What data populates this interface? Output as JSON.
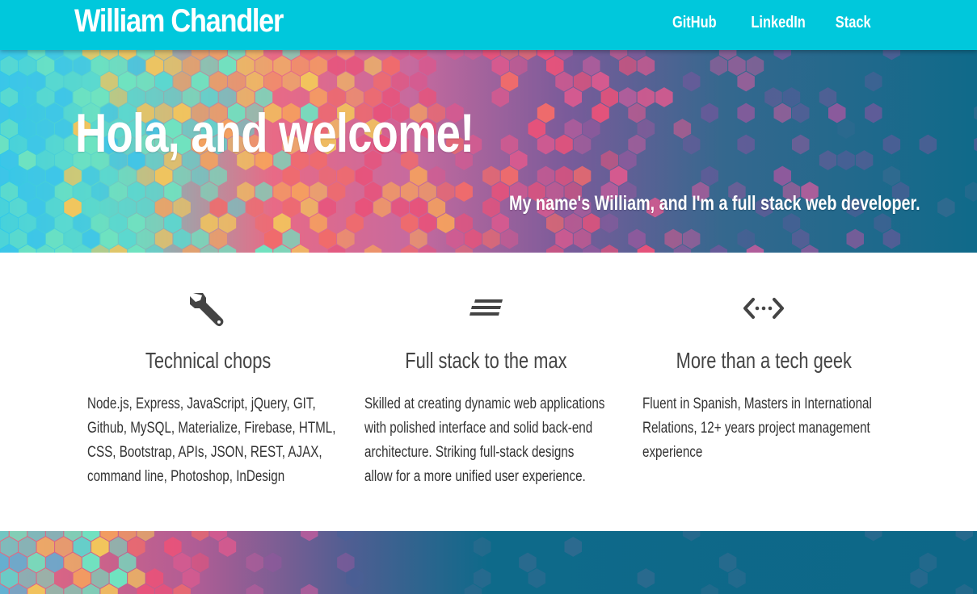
{
  "navbar": {
    "brand": "William Chandler",
    "links": [
      {
        "label": "GitHub"
      },
      {
        "label": "LinkedIn"
      },
      {
        "label": "Stack"
      }
    ],
    "background": "#00c8dc"
  },
  "hero": {
    "title": "Hola, and welcome!",
    "subtitle": "My name's William, and I'm a full stack web developer."
  },
  "features": [
    {
      "icon": "wrench-icon",
      "title": "Technical chops",
      "lines": [
        "Node.js, Express, JavaScript, jQuery, GIT,",
        "Github, MySQL, Materialize, Firebase, HTML,",
        "CSS, Bootstrap, APIs, JSON, REST, AJAX,",
        "command line, Photoshop, InDesign"
      ]
    },
    {
      "icon": "stacked-lines-icon",
      "title": "Full stack to the max",
      "lines": [
        "Skilled at creating dynamic web applications",
        "with polished interface and solid back-end",
        "architecture. Striking full-stack designs",
        "allow for a more unified user experience."
      ]
    },
    {
      "icon": "code-arrows-icon",
      "title": "More than a tech geek",
      "lines": [
        "Fluent in Spanish, Masters in International",
        "Relations, 12+ years project management",
        "experience"
      ]
    }
  ],
  "colors": {
    "accent": "#00c8dc",
    "text": "#333333",
    "heading": "#444444",
    "icon": "#444444"
  }
}
